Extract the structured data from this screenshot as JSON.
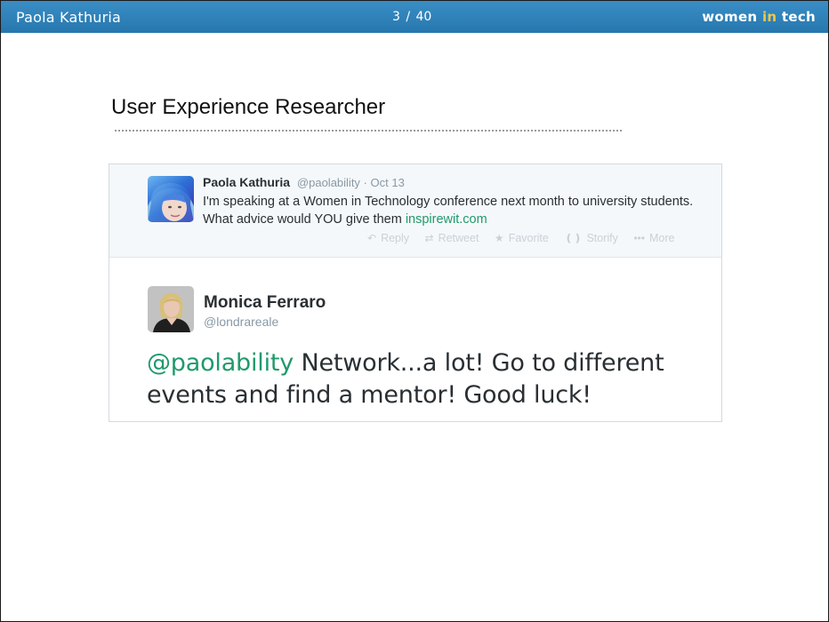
{
  "header": {
    "presenter": "Paola Kathuria",
    "pager": "3 / 40",
    "logo_prefix": "women ",
    "logo_accent": "in",
    "logo_suffix": " tech",
    "bar_color": "#2f83bb",
    "accent_color": "#f2c744"
  },
  "slide": {
    "title": "User Experience Researcher"
  },
  "reply_tweet": {
    "name": "Paola Kathuria",
    "handle": "@paolability",
    "date_sep": " · ",
    "date": "Oct 13",
    "text": "I'm speaking at a Women in Technology conference next month to university students. What advice would YOU give them ",
    "link": "inspirewit.com",
    "link_color": "#1f9a6b",
    "actions": [
      {
        "icon": "reply-icon",
        "label": "Reply"
      },
      {
        "icon": "retweet-icon",
        "label": "Retweet"
      },
      {
        "icon": "star-icon",
        "label": "Favorite"
      },
      {
        "icon": "storify-icon",
        "label": "Storify"
      },
      {
        "icon": "more-icon",
        "label": "More"
      }
    ]
  },
  "main_tweet": {
    "name": "Monica Ferraro",
    "handle": "@londrareale",
    "mention": "@paolability",
    "text": " Network...a lot! Go to different events and find a mentor! Good luck!"
  }
}
